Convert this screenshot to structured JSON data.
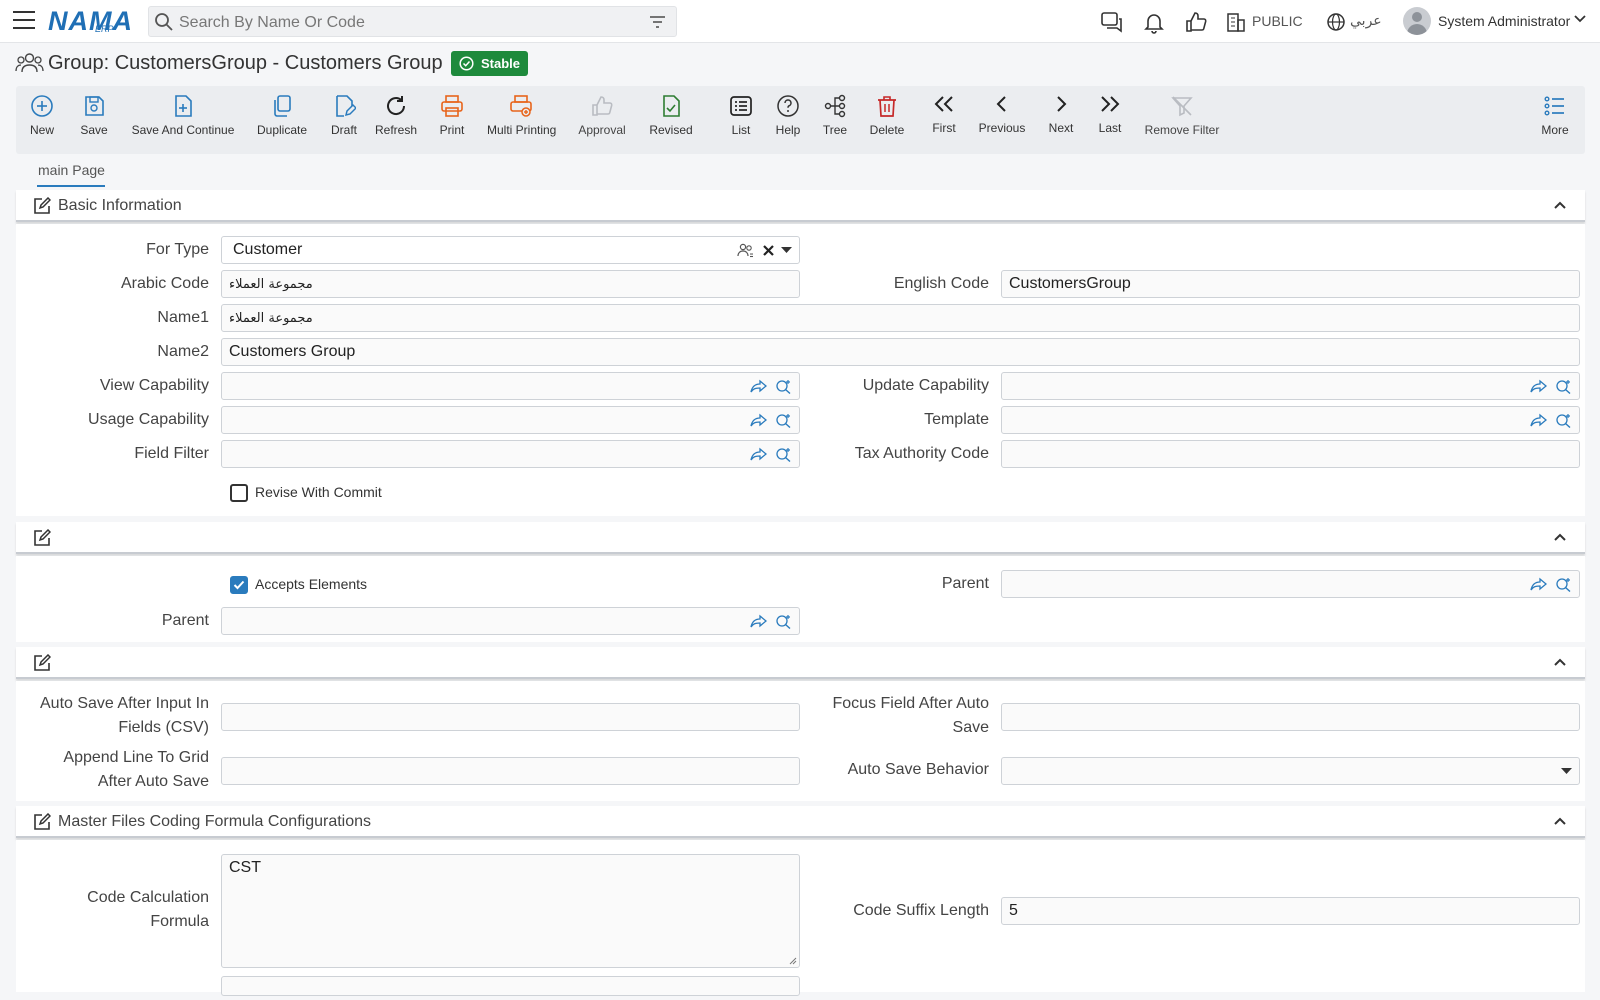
{
  "topbar": {
    "logo": "NAMA",
    "logo_sub": "ERP",
    "search_placeholder": "Search By Name Or Code",
    "public_label": "PUBLIC",
    "language_label": "عربي",
    "user_name": "System Administrator"
  },
  "page": {
    "title": "Group: CustomersGroup - Customers Group",
    "status_badge": "Stable"
  },
  "toolbar": {
    "new": "New",
    "save": "Save",
    "save_and_continue": "Save And Continue",
    "duplicate": "Duplicate",
    "draft": "Draft",
    "refresh": "Refresh",
    "print": "Print",
    "multi_printing": "Multi Printing",
    "approval": "Approval",
    "revised": "Revised",
    "list": "List",
    "help": "Help",
    "tree": "Tree",
    "delete": "Delete",
    "first": "First",
    "previous": "Previous",
    "next": "Next",
    "last": "Last",
    "remove_filter": "Remove Filter",
    "more": "More"
  },
  "tabs": {
    "main": "main Page"
  },
  "basic_info": {
    "title": "Basic Information",
    "for_type_label": "For Type",
    "for_type_value": "Customer",
    "arabic_code_label": "Arabic Code",
    "arabic_code_value": "مجموعة العملاء",
    "english_code_label": "English Code",
    "english_code_value": "CustomersGroup",
    "name1_label": "Name1",
    "name1_value": "مجموعة العملاء",
    "name2_label": "Name2",
    "name2_value": "Customers Group",
    "view_capability_label": "View Capability",
    "update_capability_label": "Update Capability",
    "usage_capability_label": "Usage Capability",
    "template_label": "Template",
    "field_filter_label": "Field Filter",
    "tax_authority_label": "Tax Authority Code",
    "revise_with_commit_label": "Revise With Commit",
    "revise_with_commit_checked": false
  },
  "tree_section": {
    "accepts_elements_label": "Accepts Elements",
    "accepts_elements_checked": true,
    "parent_label_right": "Parent",
    "parent_label_left": "Parent"
  },
  "autosave_section": {
    "auto_save_after_input_label_1": "Auto Save After Input In",
    "auto_save_after_input_label_2": "Fields (CSV)",
    "focus_field_label_1": "Focus Field After Auto",
    "focus_field_label_2": "Save",
    "append_line_label_1": "Append Line To Grid",
    "append_line_label_2": "After Auto Save",
    "auto_save_behavior_label": "Auto Save Behavior"
  },
  "coding_section": {
    "title": "Master Files Coding Formula Configurations",
    "code_calc_label_1": "Code Calculation",
    "code_calc_label_2": "Formula",
    "code_calc_value": "CST",
    "code_suffix_label": "Code Suffix Length",
    "code_suffix_value": "5"
  },
  "colors": {
    "accent": "#2a7bbd",
    "stable_badge": "#1e8a3c",
    "print_orange": "#e8641b",
    "revised_green": "#2e7d32",
    "delete_red": "#c62828"
  }
}
